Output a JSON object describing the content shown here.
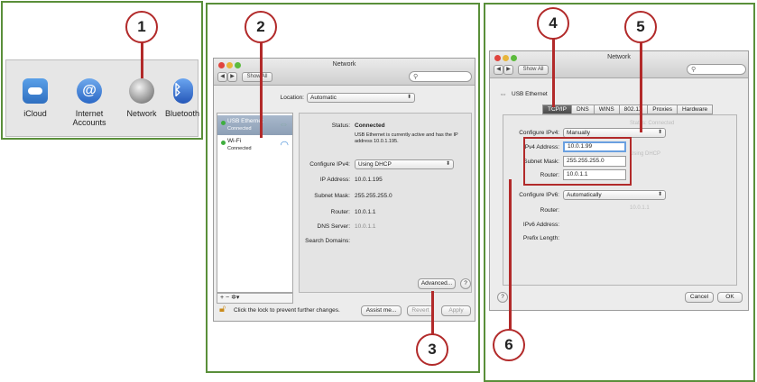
{
  "panel1": {
    "items": [
      {
        "label": "iCloud",
        "icon": "icloud-icon"
      },
      {
        "label": "Internet Accounts",
        "icon": "at-sign-icon"
      },
      {
        "label": "Network",
        "icon": "network-globe-icon"
      },
      {
        "label": "Bluetooth",
        "icon": "bluetooth-icon"
      }
    ],
    "callout": "1"
  },
  "panel2": {
    "callouts": {
      "two": "2",
      "three": "3"
    },
    "window_title": "Network",
    "nav_back": "◀",
    "nav_fwd": "▶",
    "show_all": "Show All",
    "search_placeholder": "",
    "location_label": "Location:",
    "location_value": "Automatic",
    "services": [
      {
        "name": "USB Ethernet",
        "status": "Connected",
        "icon": "ethernet-arrows-icon"
      },
      {
        "name": "Wi-Fi",
        "status": "Connected",
        "icon": "wifi-icon"
      }
    ],
    "sidebar_tools": "+  −  ✲▾",
    "status_label": "Status:",
    "status_value": "Connected",
    "status_desc": "USB Ethernet is currently active and has the IP address 10.0.1.195.",
    "configure_label": "Configure IPv4:",
    "configure_value": "Using DHCP",
    "ip_label": "IP Address:",
    "ip_value": "10.0.1.195",
    "mask_label": "Subnet Mask:",
    "mask_value": "255.255.255.0",
    "router_label": "Router:",
    "router_value": "10.0.1.1",
    "dns_label": "DNS Server:",
    "dns_value": "10.0.1.1",
    "search_domains_label": "Search Domains:",
    "advanced_btn": "Advanced...",
    "help_btn": "?",
    "lock_text": "Click the lock to prevent further changes.",
    "assist_btn": "Assist me...",
    "revert_btn": "Revert",
    "apply_btn": "Apply"
  },
  "panel3": {
    "callouts": {
      "four": "4",
      "five": "5",
      "six": "6"
    },
    "window_title": "Network",
    "show_all": "Show All",
    "device": "USB Ethernet",
    "tabs": [
      "TCP/IP",
      "DNS",
      "WINS",
      "802.1X",
      "Proxies",
      "Hardware"
    ],
    "configure_ipv4_label": "Configure IPv4:",
    "configure_ipv4_value": "Manually",
    "ipv4_address_label": "IPv4 Address:",
    "ipv4_address_value": "10.0.1.99",
    "subnet_mask_label": "Subnet Mask:",
    "subnet_mask_value": "255.255.255.0",
    "router_label": "Router:",
    "router_value": "10.0.1.1",
    "configure_ipv6_label": "Configure IPv6:",
    "configure_ipv6_value": "Automatically",
    "router6_label": "Router:",
    "ipv6_address_label": "IPv6 Address:",
    "prefix_label": "Prefix Length:",
    "help_btn": "?",
    "cancel_btn": "Cancel",
    "ok_btn": "OK"
  }
}
